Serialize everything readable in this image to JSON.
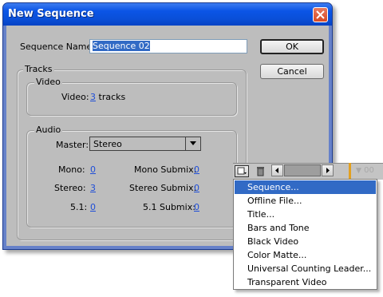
{
  "window": {
    "title": "New Sequence"
  },
  "form": {
    "sequence_name_label": "Sequence Name:",
    "sequence_name_value": "Sequence 02",
    "ok_label": "OK",
    "cancel_label": "Cancel"
  },
  "tracks": {
    "group_label": "Tracks",
    "video": {
      "group_label": "Video",
      "label": "Video:",
      "count": "3",
      "unit": "tracks"
    },
    "audio": {
      "group_label": "Audio",
      "master_label": "Master:",
      "master_value": "Stereo",
      "mono_label": "Mono:",
      "mono_value": "0",
      "stereo_label": "Stereo:",
      "stereo_value": "3",
      "five_one_label": "5.1:",
      "five_one_value": "0",
      "mono_submix_label": "Mono Submix:",
      "mono_submix_value": "0",
      "stereo_submix_label": "Stereo Submix:",
      "stereo_submix_value": "0",
      "five_one_submix_label": "5.1 Submix:",
      "five_one_submix_value": "0"
    }
  },
  "toolbar": {
    "time": "00"
  },
  "menu": {
    "items": [
      {
        "label": "Sequence..."
      },
      {
        "label": "Offline File..."
      },
      {
        "label": "Title..."
      },
      {
        "label": "Bars and Tone"
      },
      {
        "label": "Black Video"
      },
      {
        "label": "Color Matte..."
      },
      {
        "label": "Universal Counting Leader..."
      },
      {
        "label": "Transparent Video"
      }
    ],
    "active_index": 0
  },
  "colors": {
    "title_bar": "#0b55e6",
    "selection": "#316ac5",
    "link": "#1f4ed8"
  }
}
